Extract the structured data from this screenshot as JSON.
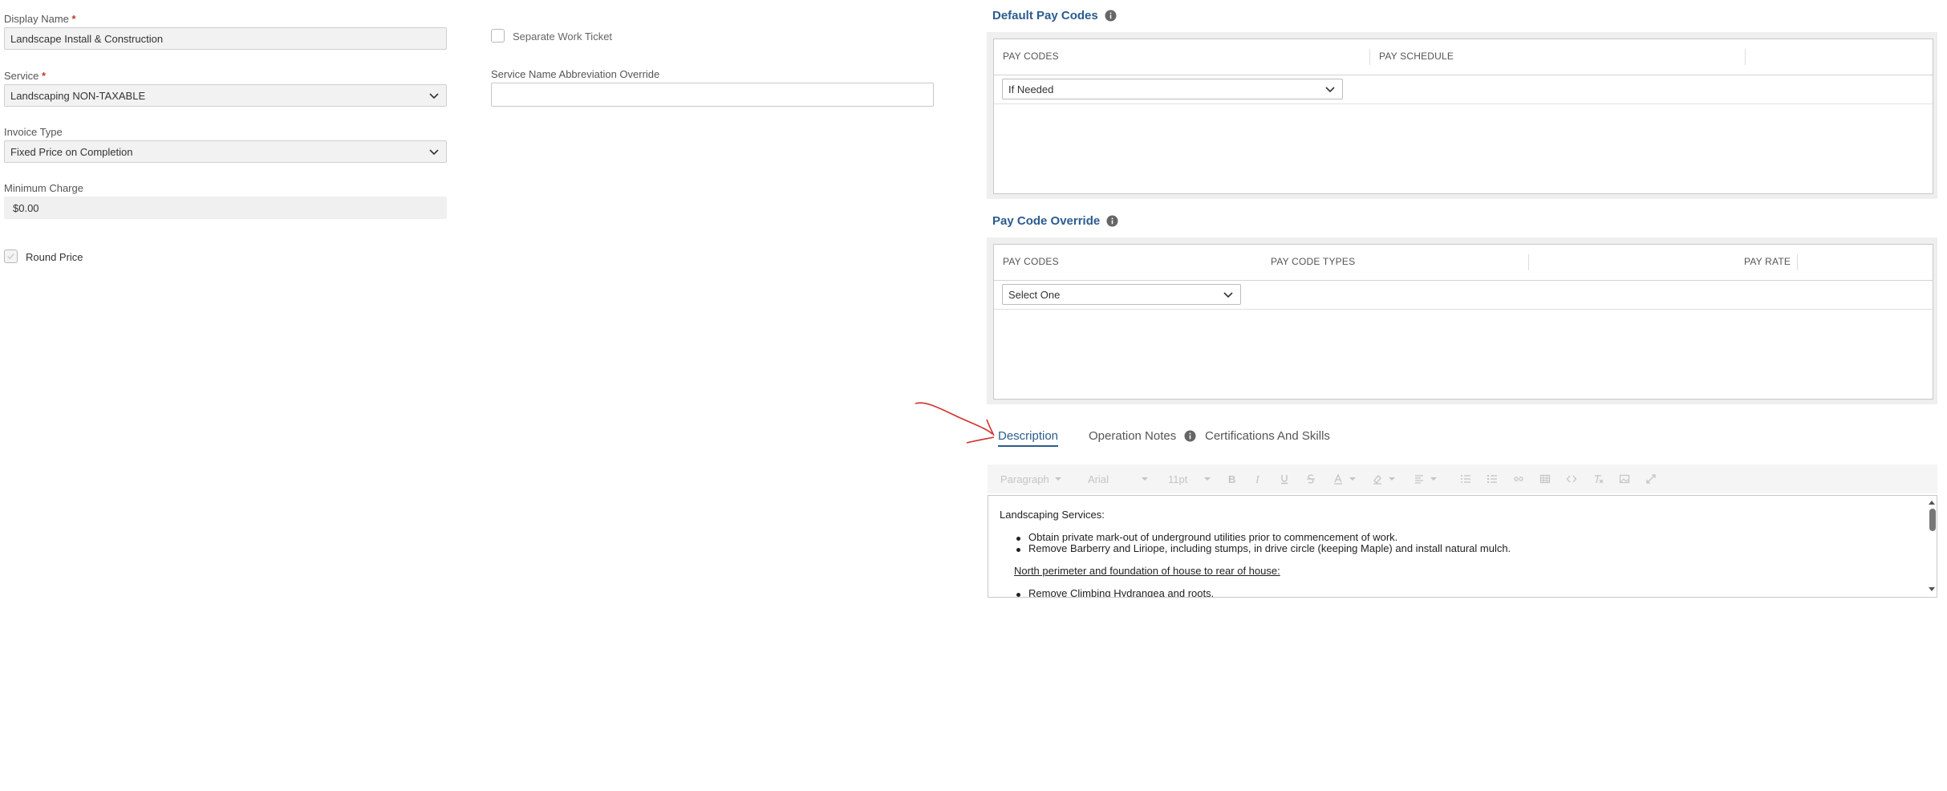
{
  "form": {
    "display_name_label": "Display Name",
    "display_name_value": "Landscape Install & Construction",
    "service_label": "Service",
    "service_value": "Landscaping NON-TAXABLE",
    "invoice_type_label": "Invoice Type",
    "invoice_type_value": "Fixed Price on Completion",
    "minimum_charge_label": "Minimum Charge",
    "minimum_charge_value": "$0.00",
    "round_price_label": "Round Price",
    "separate_ticket_label": "Separate Work Ticket",
    "abbrev_label": "Service Name Abbreviation Override",
    "abbrev_value": "",
    "required_mark": "*"
  },
  "default_pay_codes": {
    "title": "Default Pay Codes",
    "col_pay_codes": "PAY CODES",
    "col_pay_schedule": "PAY SCHEDULE",
    "select_value": "If Needed"
  },
  "pay_code_override": {
    "title": "Pay Code Override",
    "col_pay_codes": "PAY CODES",
    "col_pay_code_types": "PAY CODE TYPES",
    "col_pay_rate": "PAY RATE",
    "select_value": "Select One"
  },
  "tabs": {
    "description": "Description",
    "operation_notes": "Operation Notes",
    "certifications": "Certifications And Skills"
  },
  "toolbar": {
    "paragraph": "Paragraph",
    "font": "Arial",
    "size": "11pt"
  },
  "editor": {
    "heading": "Landscaping Services:",
    "bullets": [
      "Obtain private mark-out of underground utilities prior to commencement of work.",
      "Remove Barberry and Liriope, including stumps, in drive circle (keeping Maple) and install natural mulch."
    ],
    "subheading": "North perimeter and foundation of house to rear of house:",
    "bullets2": [
      "Remove Climbing Hydrangea and roots."
    ]
  },
  "colors": {
    "accent": "#2b5c8f",
    "required": "#c0392b",
    "annotation": "#d0312d"
  }
}
